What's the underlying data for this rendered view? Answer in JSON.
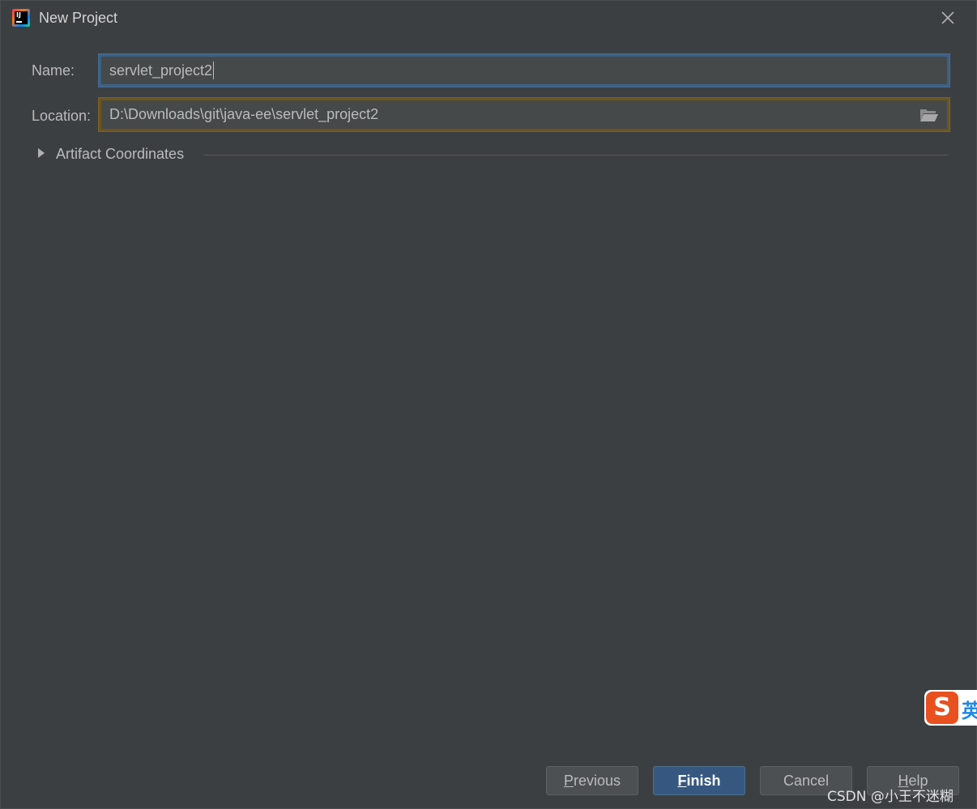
{
  "window": {
    "title": "New Project",
    "app_icon_text": "IJ"
  },
  "form": {
    "name_label": "Name:",
    "name_value": "servlet_project2",
    "location_label": "Location:",
    "location_value": "D:\\Downloads\\git\\java-ee\\servlet_project2"
  },
  "section": {
    "artifact_label": "Artifact Coordinates"
  },
  "buttons": {
    "previous_mnemonic": "P",
    "previous_rest": "revious",
    "finish_mnemonic": "F",
    "finish_rest": "inish",
    "cancel_label": "Cancel",
    "help_mnemonic": "H",
    "help_rest": "elp"
  },
  "overlay": {
    "watermark": "CSDN @小王不迷糊",
    "ime_logo": "S",
    "ime_char": "英"
  },
  "colors": {
    "background": "#3c3f41",
    "name_focus_border": "#3d6185",
    "location_border": "#6b5420",
    "primary_button": "#365880"
  },
  "icons": {
    "close": "close-icon",
    "folder": "folder-open-icon",
    "expand": "chevron-right-icon"
  }
}
